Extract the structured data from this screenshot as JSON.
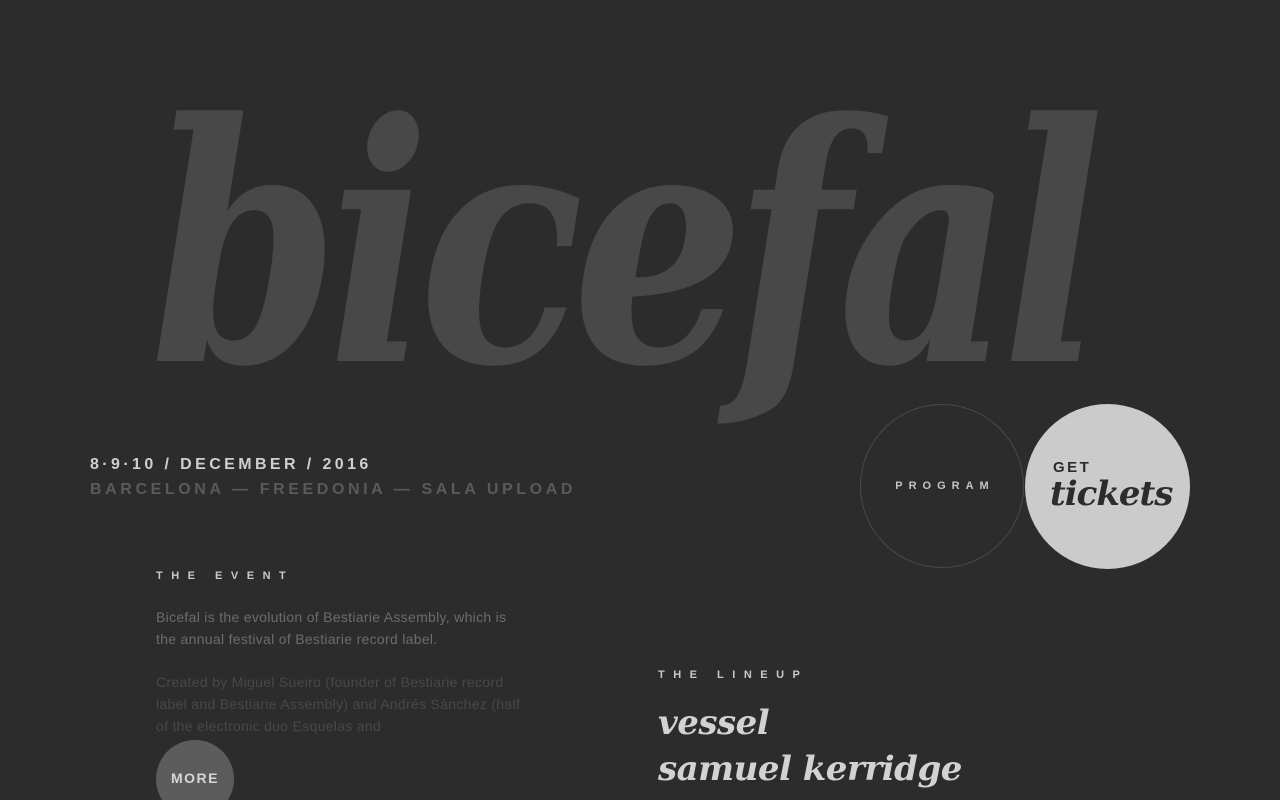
{
  "logo": {
    "text": "bicefal"
  },
  "event_info": {
    "dates": "8·9·10 / DECEMBER / 2016",
    "venue": "BARCELONA — FREEDONIA — SALA UPLOAD"
  },
  "nav": {
    "program_label": "PROGRAM",
    "tickets_prefix": "GET",
    "tickets_word": "tickets"
  },
  "event_section": {
    "heading": "THE EVENT",
    "paragraph_1": "Bicefal is the evolution of Bestiarie Assembly, which is the annual festival of Bestiarie record label.",
    "paragraph_2": "Created by Miguel Sueiro (founder of Bestiarie record label and Bestiarie Assembly) and Andrés Sánchez (half of the electronic duo Esquelas and",
    "more_label": "MORE"
  },
  "lineup_section": {
    "heading": "THE LINEUP",
    "artists": [
      "vessel",
      "samuel kerridge"
    ]
  },
  "colors": {
    "background": "#2c2c2c",
    "logo": "#484848",
    "accent_light": "#cbcbcb",
    "text_muted": "#6c6c6c"
  }
}
